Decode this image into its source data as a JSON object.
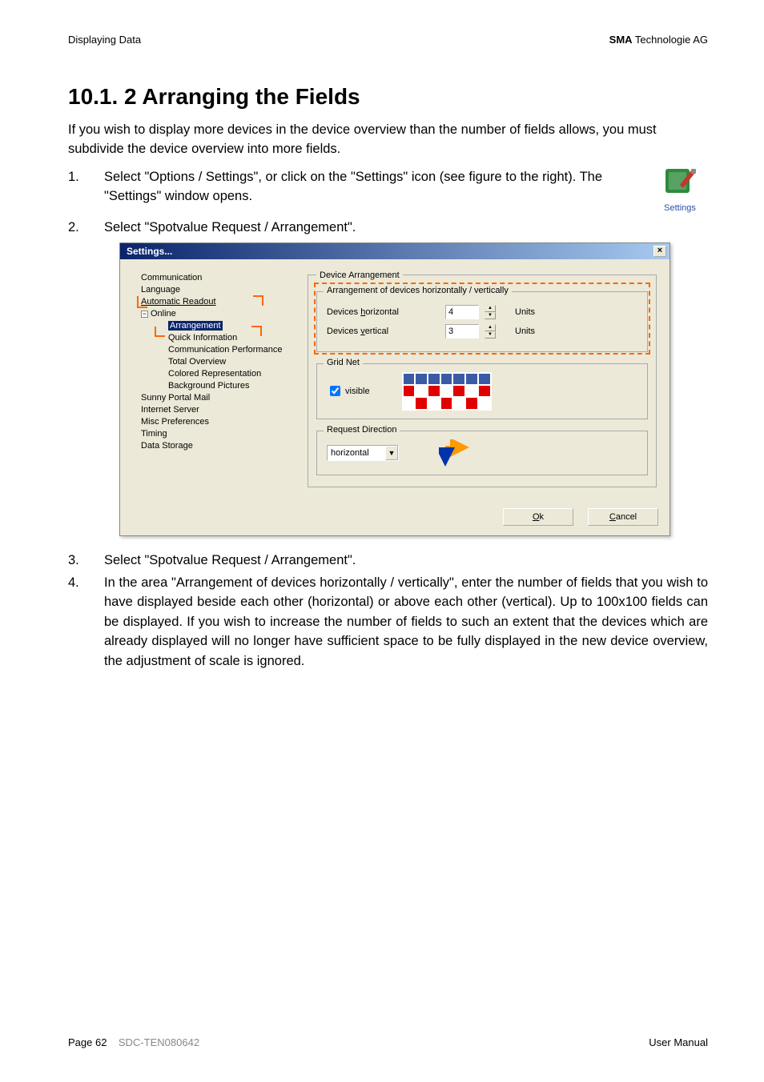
{
  "header": {
    "left": "Displaying Data",
    "right_bold": "SMA",
    "right_rest": " Technologie AG"
  },
  "title": "10.1. 2 Arranging the Fields",
  "intro": "If you wish to display more devices in the device overview than the number of fields allows, you must subdivide the device overview into more fields.",
  "step1_num": "1.",
  "step1": "Select \"Options / Settings\", or click on the \"Settings\" icon (see figure to the right). The \"Settings\" window opens.",
  "step2_num": "2.",
  "step2": "Select \"Spotvalue Request / Arrangement\".",
  "settings_icon_label": "Settings",
  "dialog": {
    "title": "Settings...",
    "tree": {
      "n0": "Communication",
      "n1": "Language",
      "n2": "Automatic Readout",
      "n3": "Online",
      "n3a": "Arrangement",
      "n3b": "Quick Information",
      "n3c": "Communication Performance",
      "n3d": "Total Overview",
      "n3e": "Colored Representation",
      "n3f": "Background Pictures",
      "n4": "Sunny Portal Mail",
      "n5": "Internet Server",
      "n6": "Misc Preferences",
      "n7": "Timing",
      "n8": "Data Storage"
    },
    "panel": {
      "outer_legend": "Device Arrangement",
      "arr_legend": "Arrangement of devices horizontally / vertically",
      "devices_h_label": "Devices horizontal",
      "devices_h_value": "4",
      "devices_v_label": "Devices vertical",
      "devices_v_value": "3",
      "units": "Units",
      "grid_legend": "Grid Net",
      "visible_label": "visible",
      "req_legend": "Request Direction",
      "req_value": "horizontal"
    },
    "ok": "Ok",
    "cancel": "Cancel"
  },
  "step3_num": "3.",
  "step3": "Select \"Spotvalue Request / Arrangement\".",
  "step4_num": "4.",
  "step4": "In the area \"Arrangement of devices horizontally / vertically\", enter the number of fields that you wish to have displayed beside each other (horizontal) or above each other (vertical). Up to 100x100 fields can be displayed. If you wish to increase the number of fields to such an extent that the devices which are already displayed will no longer have sufficient space to be fully displayed in the new device overview, the adjustment of scale is ignored.",
  "footer": {
    "page": "Page 62",
    "doc": "SDC-TEN080642",
    "manual": "User Manual"
  }
}
